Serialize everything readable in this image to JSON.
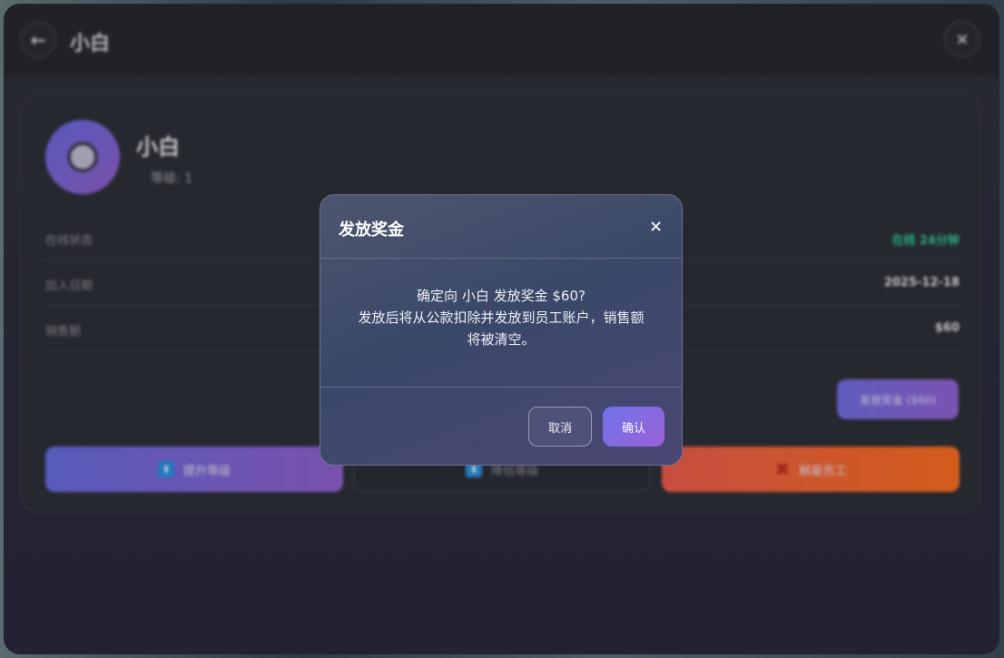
{
  "window": {
    "title": "小白",
    "back_icon": "←",
    "close_icon": "×"
  },
  "employee": {
    "name": "小白",
    "level_text": "等级: 1",
    "rows": [
      {
        "label": "在线状态",
        "value": "在线 24分钟"
      },
      {
        "label": "加入日期",
        "value": "2025-12-18"
      },
      {
        "label": "销售额",
        "value": "$60"
      }
    ],
    "bonus_button": "发放奖金 ($60)",
    "actions": {
      "promote": "提升等级",
      "demote": "降低等级",
      "fire": "解雇员工"
    }
  },
  "modal": {
    "title": "发放奖金",
    "close_icon": "×",
    "lines": [
      "确定向 小白 发放奖金 $60?",
      "发放后将从公款扣除并发放到员工账户，销售额",
      "将被清空。"
    ],
    "cancel": "取消",
    "confirm": "确认"
  },
  "colors": {
    "accent": "#7a68e0",
    "online": "#2ec28a",
    "danger": "#f06a1e"
  }
}
